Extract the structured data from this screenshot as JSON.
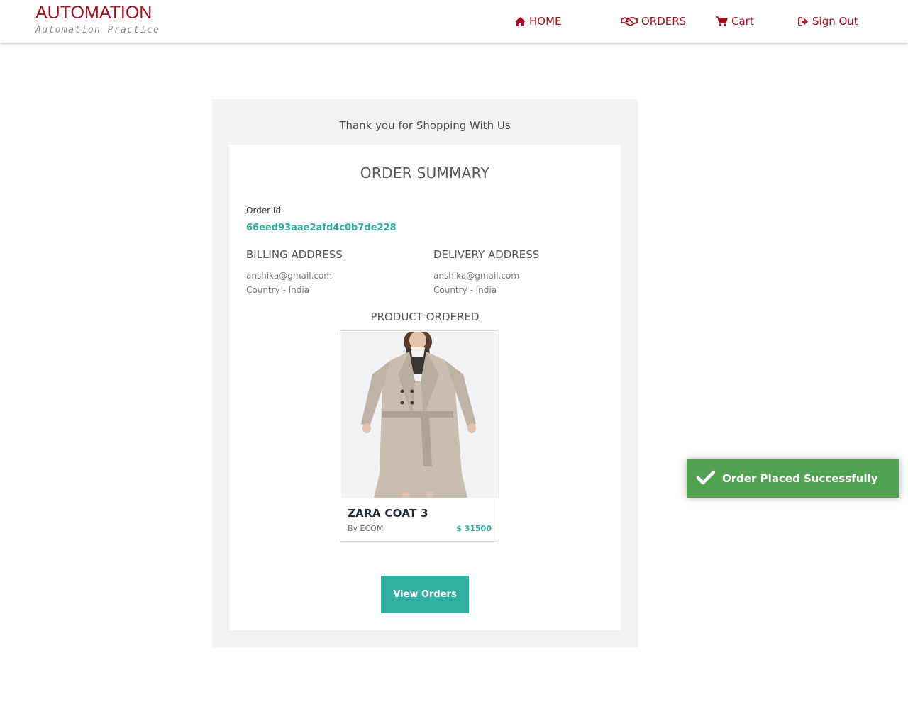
{
  "header": {
    "brand_title": "AUTOMATION",
    "brand_subtitle": "Automation Practice",
    "nav": {
      "home": "HOME",
      "orders": "ORDERS",
      "cart": "Cart",
      "sign_out": "Sign Out"
    },
    "brand_color": "#a3101f"
  },
  "main": {
    "thanks": "Thank you for Shopping With Us",
    "summary_title": "ORDER SUMMARY",
    "order_id_label": "Order Id",
    "order_id_value": "66eed93aae2afd4c0b7de228",
    "billing": {
      "heading": "BILLING ADDRESS",
      "email": "anshika@gmail.com",
      "country": "Country - India"
    },
    "delivery": {
      "heading": "DELIVERY ADDRESS",
      "email": "anshika@gmail.com",
      "country": "Country - India"
    },
    "product_ordered_label": "PRODUCT ORDERED",
    "product": {
      "name": "ZARA COAT 3",
      "by": "By ECOM",
      "price": "$ 31500",
      "image_icon": "coat-product-image"
    },
    "view_orders_label": "View Orders",
    "accent_color": "#31afa3"
  },
  "toast": {
    "message": "Order Placed Successfully",
    "icon": "check-icon",
    "color": "#51a351"
  }
}
